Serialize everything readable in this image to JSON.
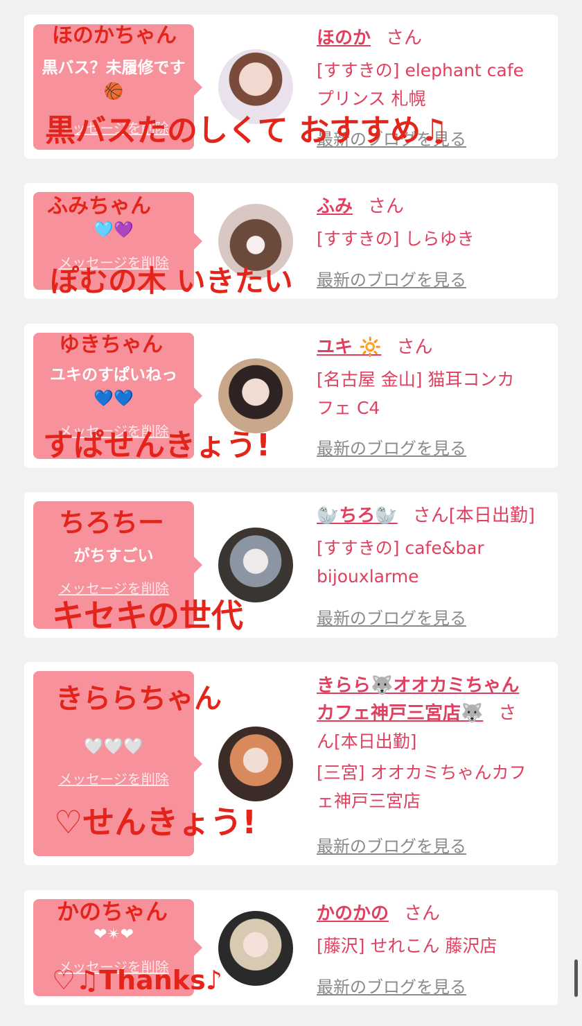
{
  "cards": [
    {
      "bubble_text": "黒バス？未履修です🏀",
      "delete_label": "メッセージを削除",
      "name": "ほのか",
      "san": "さん",
      "shop_line1": "[すすきの] elephant cafe",
      "shop_line2": "プリンス 札幌",
      "blog_label": "最新のブログを見る",
      "handwriting_name": "ほのかちゃん",
      "handwriting_note": "黒バスたのしくて おすすめ♫"
    },
    {
      "bubble_text": "🩵💜",
      "delete_label": "メッセージを削除",
      "name": "ふみ",
      "san": "さん",
      "shop_line1": "[すすきの] しらゆき",
      "blog_label": "最新のブログを見る",
      "handwriting_name": "ふみちゃん",
      "handwriting_note": "ぽむの木 いきたい"
    },
    {
      "bubble_text": "ユキのすぱいねっ💙💙",
      "delete_label": "メッセージを削除",
      "name": "ユキ 🔆",
      "san": "さん",
      "shop_line1": "[名古屋 金山] 猫耳コンカ",
      "shop_line2": "フェ C4",
      "blog_label": "最新のブログを見る",
      "handwriting_name": "ゆきちゃん",
      "handwriting_note": "すぱせんきょう!"
    },
    {
      "bubble_text": "がちすごい",
      "delete_label": "メッセージを削除",
      "name": "🦭ちろ🦭",
      "san": "さん[本日出勤]",
      "shop_line1": "[すすきの] cafe&bar",
      "shop_line2": "bijouxlarme",
      "blog_label": "最新のブログを見る",
      "handwriting_name": "ちろちー",
      "handwriting_note": "キセキの世代"
    },
    {
      "bubble_text": "🤍🤍🤍",
      "delete_label": "メッセージを削除",
      "name_line1": "きらら🐺オオカミちゃん",
      "name_line2": "カフェ神戸三宮店🐺",
      "san": "さ",
      "san_line2": "ん[本日出勤]",
      "shop_line1": "[三宮] オオカミちゃんカフ",
      "shop_line2": "ェ神戸三宮店",
      "blog_label": "最新のブログを見る",
      "handwriting_name": "きららちゃん",
      "handwriting_note": "♡せんきょう!"
    },
    {
      "bubble_text": "❤︎✴︎❤︎",
      "delete_label": "メッセージを削除",
      "name": "かのかの",
      "san": "さん",
      "shop_line1": "[藤沢] せれこん 藤沢店",
      "blog_label": "最新のブログを見る",
      "handwriting_name": "かのちゃん",
      "handwriting_note": "♡♫Thanks♪"
    }
  ],
  "colors": {
    "bubble": "#f7919b",
    "accent": "#e0405f",
    "handwriting": "#e3241b",
    "background": "#f1f1f1"
  }
}
